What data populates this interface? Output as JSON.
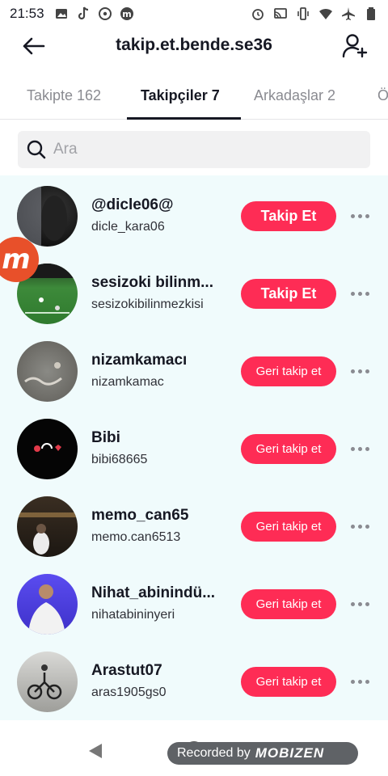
{
  "status_bar": {
    "time": "21:53",
    "left_icons": [
      "image-icon",
      "tiktok-icon",
      "chat-icon",
      "mobizen-icon"
    ],
    "right_icons": [
      "alarm-icon",
      "cast-icon",
      "vibrate-icon",
      "wifi-icon",
      "airplane-icon",
      "battery-icon"
    ]
  },
  "header": {
    "title": "takip.et.bende.se36"
  },
  "tabs": [
    {
      "label": "Takipte 162",
      "active": false
    },
    {
      "label": "Takipçiler 7",
      "active": true
    },
    {
      "label": "Arkadaşlar 2",
      "active": false
    },
    {
      "label": "Ö",
      "active": false
    }
  ],
  "search": {
    "placeholder": "Ara"
  },
  "followers": [
    {
      "name": "@dicle06@",
      "handle": "dicle_kara06",
      "button": "Takip Et"
    },
    {
      "name": "sesizoki bilinm...",
      "handle": "sesizokibilinmezkisi",
      "button": "Takip Et"
    },
    {
      "name": "nizamkamacı",
      "handle": "nizamkamac",
      "button": "Geri takip et"
    },
    {
      "name": "Bibi",
      "handle": "bibi68665",
      "button": "Geri takip et"
    },
    {
      "name": "memo_can65",
      "handle": "memo.can6513",
      "button": "Geri takip et"
    },
    {
      "name": "Nihat_abinindü...",
      "handle": "nihatabininyeri",
      "button": "Geri takip et"
    },
    {
      "name": "Arastut07",
      "handle": "aras1905gs0",
      "button": "Geri takip et"
    }
  ],
  "overlay": {
    "mobizen_letter": "m"
  },
  "recording": {
    "text": "Recorded by",
    "brand": "MOBIZEN"
  },
  "colors": {
    "accent": "#fe2c55",
    "list_bg": "#f0fbfc"
  }
}
